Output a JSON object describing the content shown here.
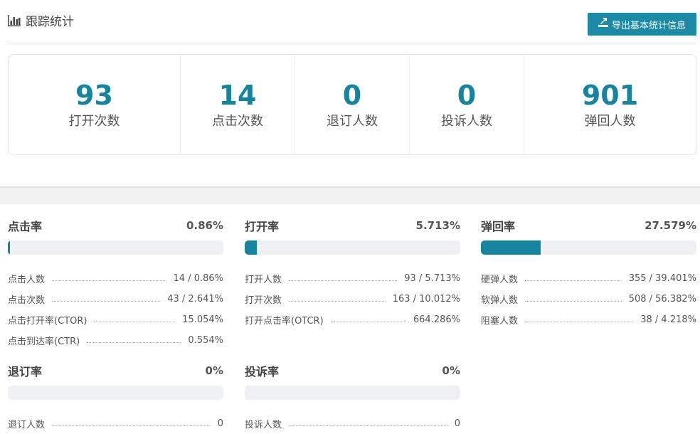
{
  "header": {
    "title": "跟踪统计",
    "title_icon": "bar-chart-icon",
    "export_label": "导出基本统计信息",
    "export_icon": "export-icon"
  },
  "summary": [
    {
      "value": "93",
      "label": "打开次数"
    },
    {
      "value": "14",
      "label": "点击次数"
    },
    {
      "value": "0",
      "label": "退订人数"
    },
    {
      "value": "0",
      "label": "投诉人数"
    },
    {
      "value": "901",
      "label": "弹回人数"
    }
  ],
  "metrics": [
    {
      "name": "点击率",
      "percent": "0.86%",
      "fill": 0.0086,
      "rows": [
        {
          "label": "点击人数",
          "value": "14 / 0.86%"
        },
        {
          "label": "点击次数",
          "value": "43 / 2.641%"
        },
        {
          "label": "点击打开率(CTOR)",
          "value": "15.054%"
        },
        {
          "label": "点击到达率(CTR)",
          "value": "0.554%"
        }
      ]
    },
    {
      "name": "打开率",
      "percent": "5.713%",
      "fill": 0.05713,
      "rows": [
        {
          "label": "打开人数",
          "value": "93 / 5.713%"
        },
        {
          "label": "打开次数",
          "value": "163 / 10.012%"
        },
        {
          "label": "打开点击率(OTCR)",
          "value": "664.286%"
        }
      ]
    },
    {
      "name": "弹回率",
      "percent": "27.579%",
      "fill": 0.27579,
      "rows": [
        {
          "label": "硬弹人数",
          "value": "355 / 39.401%"
        },
        {
          "label": "软弹人数",
          "value": "508 / 56.382%"
        },
        {
          "label": "阻塞人数",
          "value": "38 / 4.218%"
        }
      ]
    },
    {
      "name": "退订率",
      "percent": "0%",
      "fill": 0,
      "rows": [
        {
          "label": "退订人数",
          "value": "0"
        }
      ]
    },
    {
      "name": "投诉率",
      "percent": "0%",
      "fill": 0,
      "rows": [
        {
          "label": "投诉人数",
          "value": "0"
        }
      ]
    }
  ],
  "colors": {
    "accent": "#16849e",
    "button": "#1a8aa6",
    "bar_track": "#eef0f3"
  }
}
